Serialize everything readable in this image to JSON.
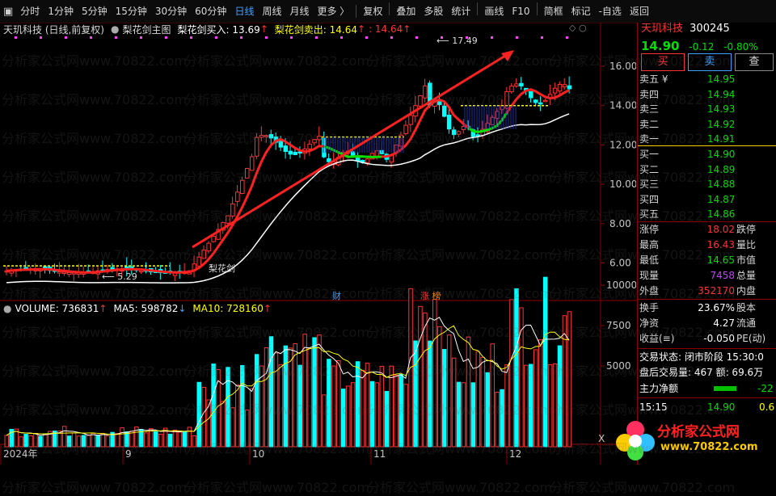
{
  "toolbar": {
    "periods": [
      "分时",
      "1分钟",
      "5分钟",
      "15分钟",
      "30分钟",
      "60分钟",
      "日线",
      "周线",
      "月线",
      "更多 〉"
    ],
    "active_period": "日线",
    "tools": [
      "复权",
      "叠加",
      "多股",
      "统计",
      "画线",
      "F10",
      "简框",
      "标记",
      "-自选",
      "返回"
    ]
  },
  "chart_header": {
    "stock": "天玑科技 (日线,前复权)",
    "indicator": "梨花剑主图",
    "buy_label": "梨花剑买入: 13.69",
    "sell_label": "梨花剑卖出: 14.64",
    "sell_extra": ": 14.64"
  },
  "annotations": {
    "high_label": "17.49",
    "low_label": "5.29",
    "pear_label": "梨花剑",
    "cai": "财",
    "zhang": "涨",
    "bang": "榜"
  },
  "price_axis": [
    "16.00",
    "14.00",
    "12.00",
    "10.00",
    "8.00",
    "6.00"
  ],
  "volume_header": {
    "volume": "VOLUME: 736831",
    "ma5": "MA5: 598782",
    "ma10": "MA10: 728160"
  },
  "volume_axis": [
    "10000",
    "7500",
    "5000"
  ],
  "volume_axis_unit": "X",
  "date_axis": [
    "2024年",
    "9",
    "10",
    "11",
    "12"
  ],
  "quote": {
    "name": "天玑科技",
    "code": "300245",
    "price": "14.90",
    "change": "-0.12",
    "change_pct": "-0.80%",
    "buy_button": "买",
    "sell_button": "卖",
    "query_button": "查"
  },
  "order_book": {
    "asks": [
      {
        "label": "卖五 ¥",
        "price": "14.95"
      },
      {
        "label": "卖四",
        "price": "14.94"
      },
      {
        "label": "卖三",
        "price": "14.93"
      },
      {
        "label": "卖二",
        "price": "14.92"
      },
      {
        "label": "卖一",
        "price": "14.91"
      }
    ],
    "bids": [
      {
        "label": "买一",
        "price": "14.90"
      },
      {
        "label": "买二",
        "price": "14.89"
      },
      {
        "label": "买三",
        "price": "14.88"
      },
      {
        "label": "买四",
        "price": "14.87"
      },
      {
        "label": "买五",
        "price": "14.86"
      }
    ]
  },
  "stats": [
    {
      "l1": "涨停",
      "v1": "18.02",
      "l2": "跌停"
    },
    {
      "l1": "最高",
      "v1": "16.43",
      "l2": "量比"
    },
    {
      "l1": "最低",
      "v1": "14.65",
      "l2": "市值"
    },
    {
      "l1": "现量",
      "v1": "7458",
      "l2": "总量"
    },
    {
      "l1": "外盘",
      "v1": "352170",
      "l2": "内盘"
    }
  ],
  "stats2": [
    {
      "l1": "换手",
      "v1": "23.67%",
      "l2": "股本"
    },
    {
      "l1": "净资",
      "v1": "4.27",
      "l2": "流通"
    },
    {
      "l1": "收益(≡)",
      "v1": "-0.050",
      "l2": "PE(动)"
    }
  ],
  "status": {
    "state": "交易状态: 闭市阶段 15:30:0",
    "after_hours": "盘后交易量: 467  额: 69.6万",
    "net_label": "主力净额",
    "net_value": "-22",
    "time": "15:15",
    "last_price": "14.90",
    "last_vol": "0.6"
  },
  "watermark": "分析家公式网www.70822.com",
  "logo": {
    "text": "分析家公式网",
    "url": "www.70822.com"
  },
  "colors": {
    "up": "#ff3333",
    "down": "#00ffff",
    "bg": "#000000",
    "ma_white": "#ffffff",
    "ma_yellow": "#ffff00",
    "signal_green": "#00e000"
  }
}
